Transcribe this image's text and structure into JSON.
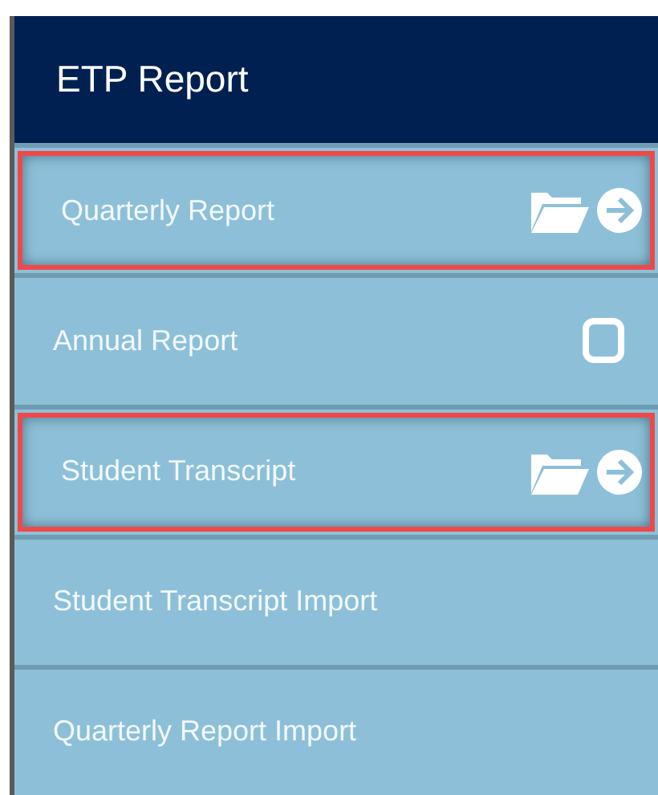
{
  "header": {
    "title": "ETP Report"
  },
  "items": [
    {
      "label": "Quarterly Report",
      "highlighted": true,
      "kind": "folder-arrow"
    },
    {
      "label": "Annual Report",
      "highlighted": false,
      "kind": "square"
    },
    {
      "label": "Student Transcript",
      "highlighted": true,
      "kind": "folder-arrow"
    },
    {
      "label": "Student Transcript Import",
      "highlighted": false,
      "kind": "plain"
    },
    {
      "label": "Quarterly Report Import",
      "highlighted": false,
      "kind": "plain"
    }
  ]
}
